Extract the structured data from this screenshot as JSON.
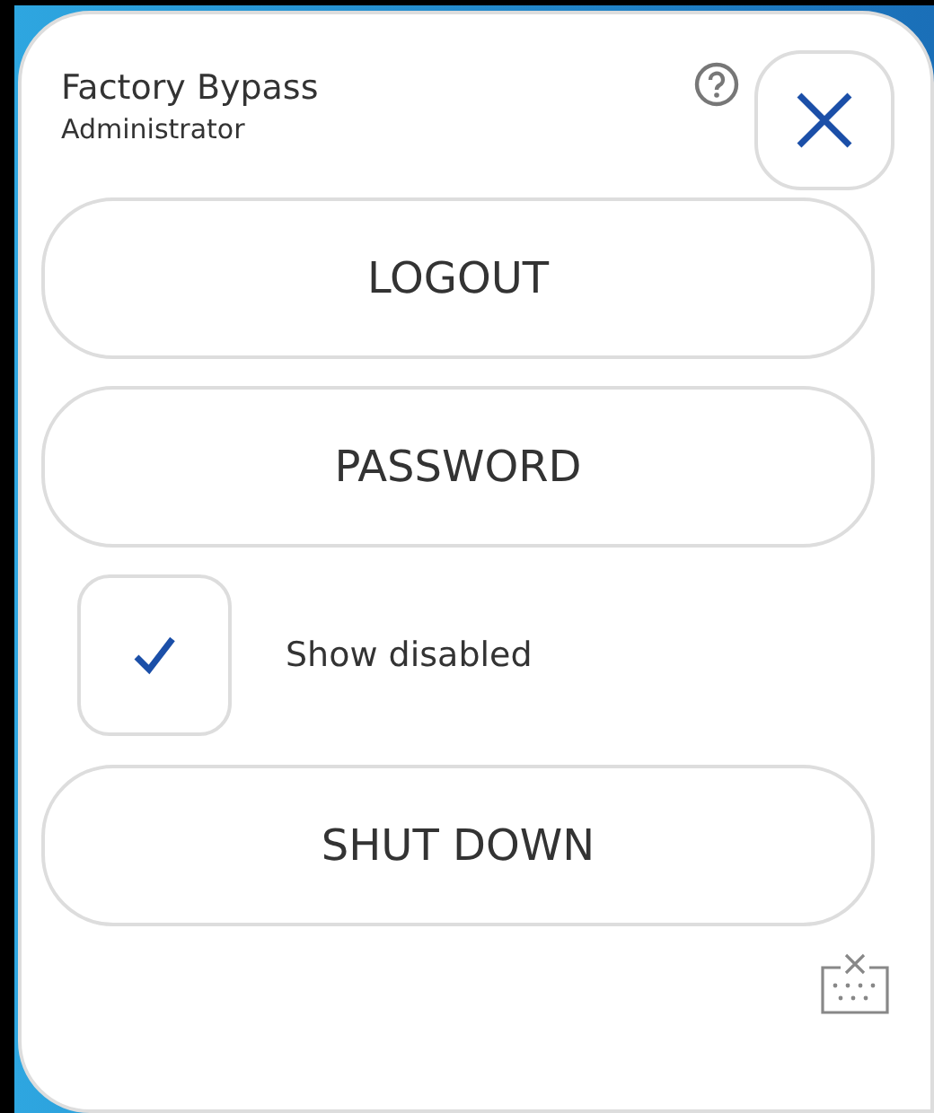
{
  "header": {
    "title": "Factory Bypass",
    "subtitle": "Administrator"
  },
  "buttons": [
    {
      "label": "LOGOUT"
    },
    {
      "label": "PASSWORD"
    }
  ],
  "show_disabled": {
    "label": "Show disabled",
    "checked": true
  },
  "bottom_buttons": [
    {
      "label": "SHUT DOWN"
    }
  ]
}
